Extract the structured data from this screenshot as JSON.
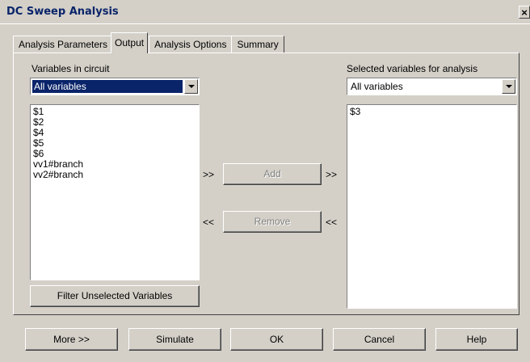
{
  "window": {
    "title": "DC Sweep Analysis",
    "close_glyph": "×"
  },
  "tabs": [
    {
      "label": "Analysis Parameters"
    },
    {
      "label": "Output"
    },
    {
      "label": "Analysis Options"
    },
    {
      "label": "Summary"
    }
  ],
  "active_tab": "Output",
  "left": {
    "label": "Variables in circuit",
    "combo_value": "All variables",
    "items": [
      "$1",
      "$2",
      "$4",
      "$5",
      "$6",
      "vv1#branch",
      "vv2#branch"
    ],
    "filter_button": "Filter Unselected Variables"
  },
  "middle": {
    "add_prefix": ">>",
    "add_label": "Add",
    "add_suffix": ">>",
    "remove_prefix": "<<",
    "remove_label": "Remove",
    "remove_suffix": "<<"
  },
  "right": {
    "label": "Selected variables for analysis",
    "combo_value": "All variables",
    "items": [
      "$3"
    ]
  },
  "footer": {
    "more": "More >>",
    "simulate": "Simulate",
    "ok": "OK",
    "cancel": "Cancel",
    "help": "Help"
  },
  "colors": {
    "face": "#d4d0c8",
    "selection": "#0a246a",
    "title_text": "#0a246a",
    "disabled_text": "#808080"
  }
}
